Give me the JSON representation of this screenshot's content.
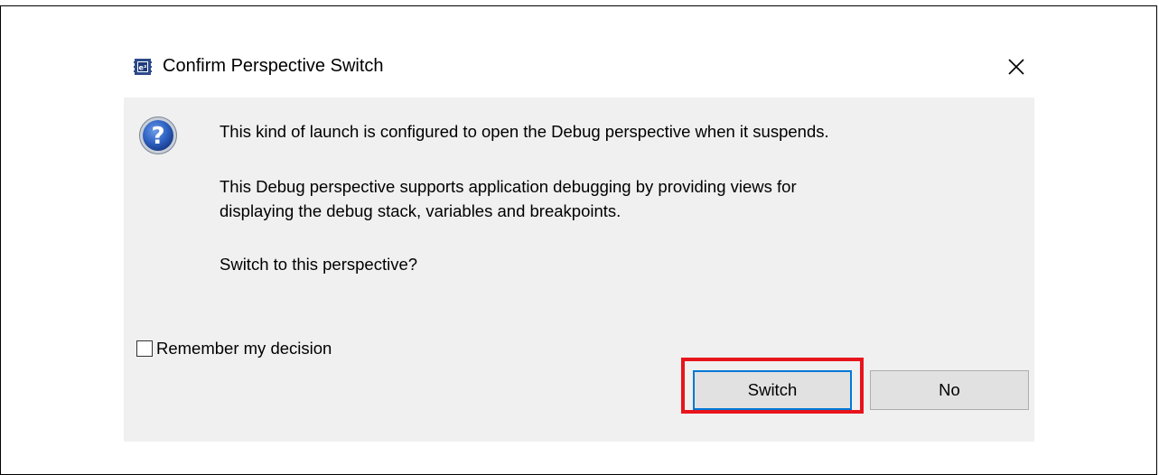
{
  "dialog": {
    "title": "Confirm Perspective Switch",
    "app_icon": "eclipse-ide-chip-icon",
    "close_icon": "close-icon",
    "message_icon": "question-icon",
    "message_lines": [
      "This kind of launch is configured to open the Debug perspective when it suspends.",
      "This Debug perspective supports application debugging by providing views for",
      "displaying the debug stack, variables and breakpoints.",
      "Switch to this perspective?"
    ],
    "remember_checkbox": {
      "label": "Remember my decision",
      "checked": false
    },
    "buttons": {
      "switch_label": "Switch",
      "no_label": "No"
    },
    "highlight_color": "#e8141c",
    "focus_color": "#0078d7"
  }
}
